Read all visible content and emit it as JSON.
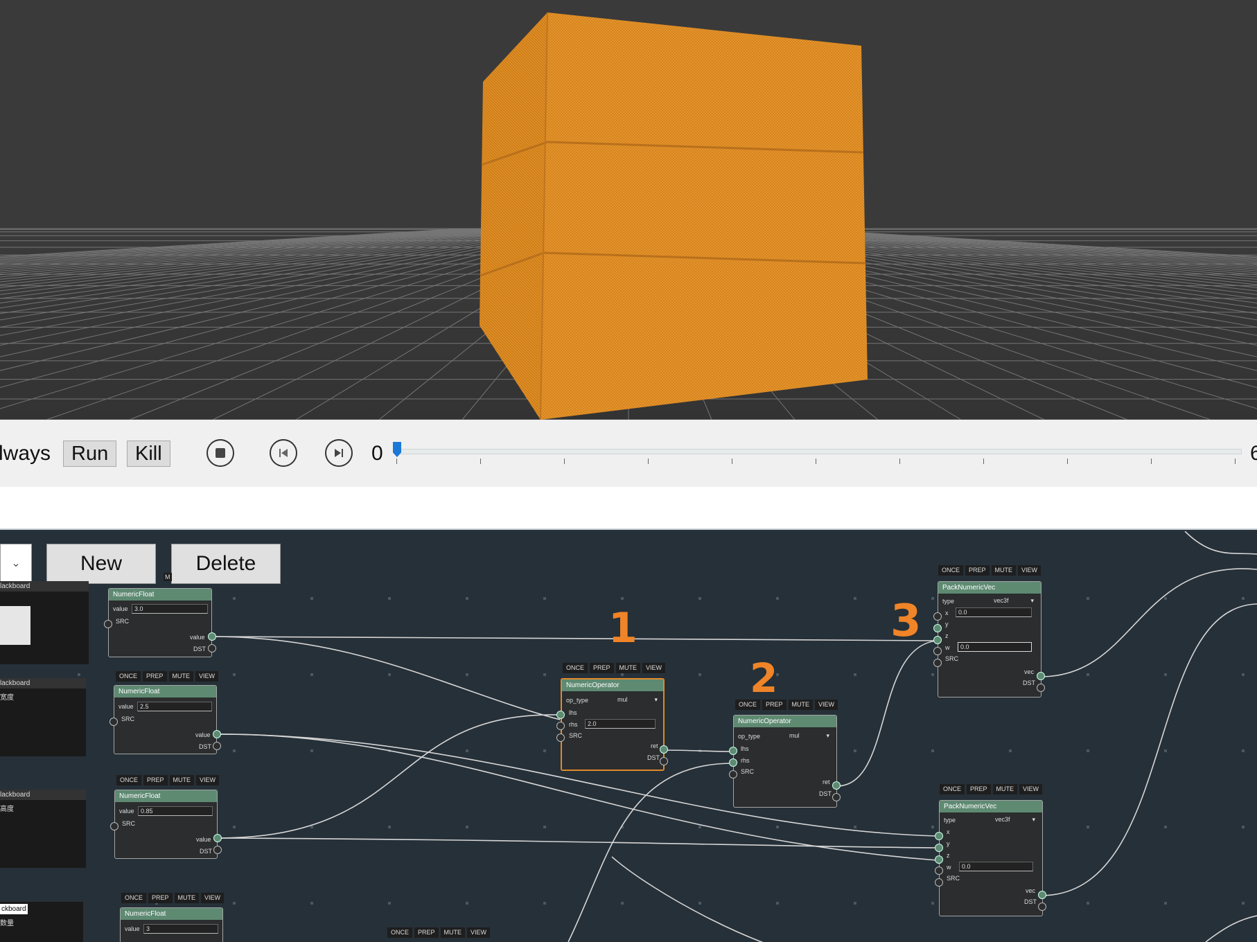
{
  "timeline": {
    "mode_label": "lways",
    "run_label": "Run",
    "kill_label": "Kill",
    "frame_current": "0",
    "frame_end_partial": "6"
  },
  "editor": {
    "new_label": "New",
    "delete_label": "Delete",
    "combo_icon": "chevron-down-icon",
    "small_tag": "M"
  },
  "blackboards": [
    {
      "title": "lackboard",
      "text": ""
    },
    {
      "title": "lackboard",
      "text": "宽度"
    },
    {
      "title": "lackboard",
      "text": "高度"
    },
    {
      "title": "ckboard",
      "text": "数量"
    }
  ],
  "toolbar_labels": [
    "ONCE",
    "PREP",
    "MUTE",
    "VIEW"
  ],
  "nodes": {
    "float_a": {
      "title": "NumericFloat",
      "value_label": "value",
      "value": "3.0",
      "src": "SRC",
      "out_value": "value",
      "dst": "DST"
    },
    "float_b": {
      "title": "NumericFloat",
      "value_label": "value",
      "value": "2.5",
      "src": "SRC",
      "out_value": "value",
      "dst": "DST"
    },
    "float_c": {
      "title": "NumericFloat",
      "value_label": "value",
      "value": "0.85",
      "src": "SRC",
      "out_value": "value",
      "dst": "DST"
    },
    "float_d": {
      "title": "NumericFloat",
      "value_label": "value",
      "value": "3"
    },
    "op_a": {
      "title": "NumericOperator",
      "op_label": "op_type",
      "op_value": "mul",
      "lhs": "lhs",
      "rhs": "rhs",
      "rhs_value": "2.0",
      "src": "SRC",
      "ret": "ret",
      "dst": "DST"
    },
    "op_b": {
      "title": "NumericOperator",
      "op_label": "op_type",
      "op_value": "mul",
      "lhs": "lhs",
      "rhs": "rhs",
      "src": "SRC",
      "ret": "ret",
      "dst": "DST"
    },
    "pack_a": {
      "title": "PackNumericVec",
      "type_label": "type",
      "type_value": "vec3f",
      "x": "x",
      "x_value": "0.0",
      "y": "y",
      "z": "z",
      "w": "w",
      "w_value": "0.0",
      "src": "SRC",
      "vec": "vec",
      "dst": "DST"
    },
    "pack_b": {
      "title": "PackNumericVec",
      "type_label": "type",
      "type_value": "vec3f",
      "x": "x",
      "y": "y",
      "z": "z",
      "w": "w",
      "w_value": "0.0",
      "src": "SRC",
      "vec": "vec",
      "dst": "DST"
    }
  },
  "annotations": [
    "1",
    "2",
    "3"
  ],
  "colors": {
    "accent": "#e08a2c",
    "node_header": "#5e8a72",
    "cube": "#e8962a",
    "graph_bg": "#263038"
  }
}
